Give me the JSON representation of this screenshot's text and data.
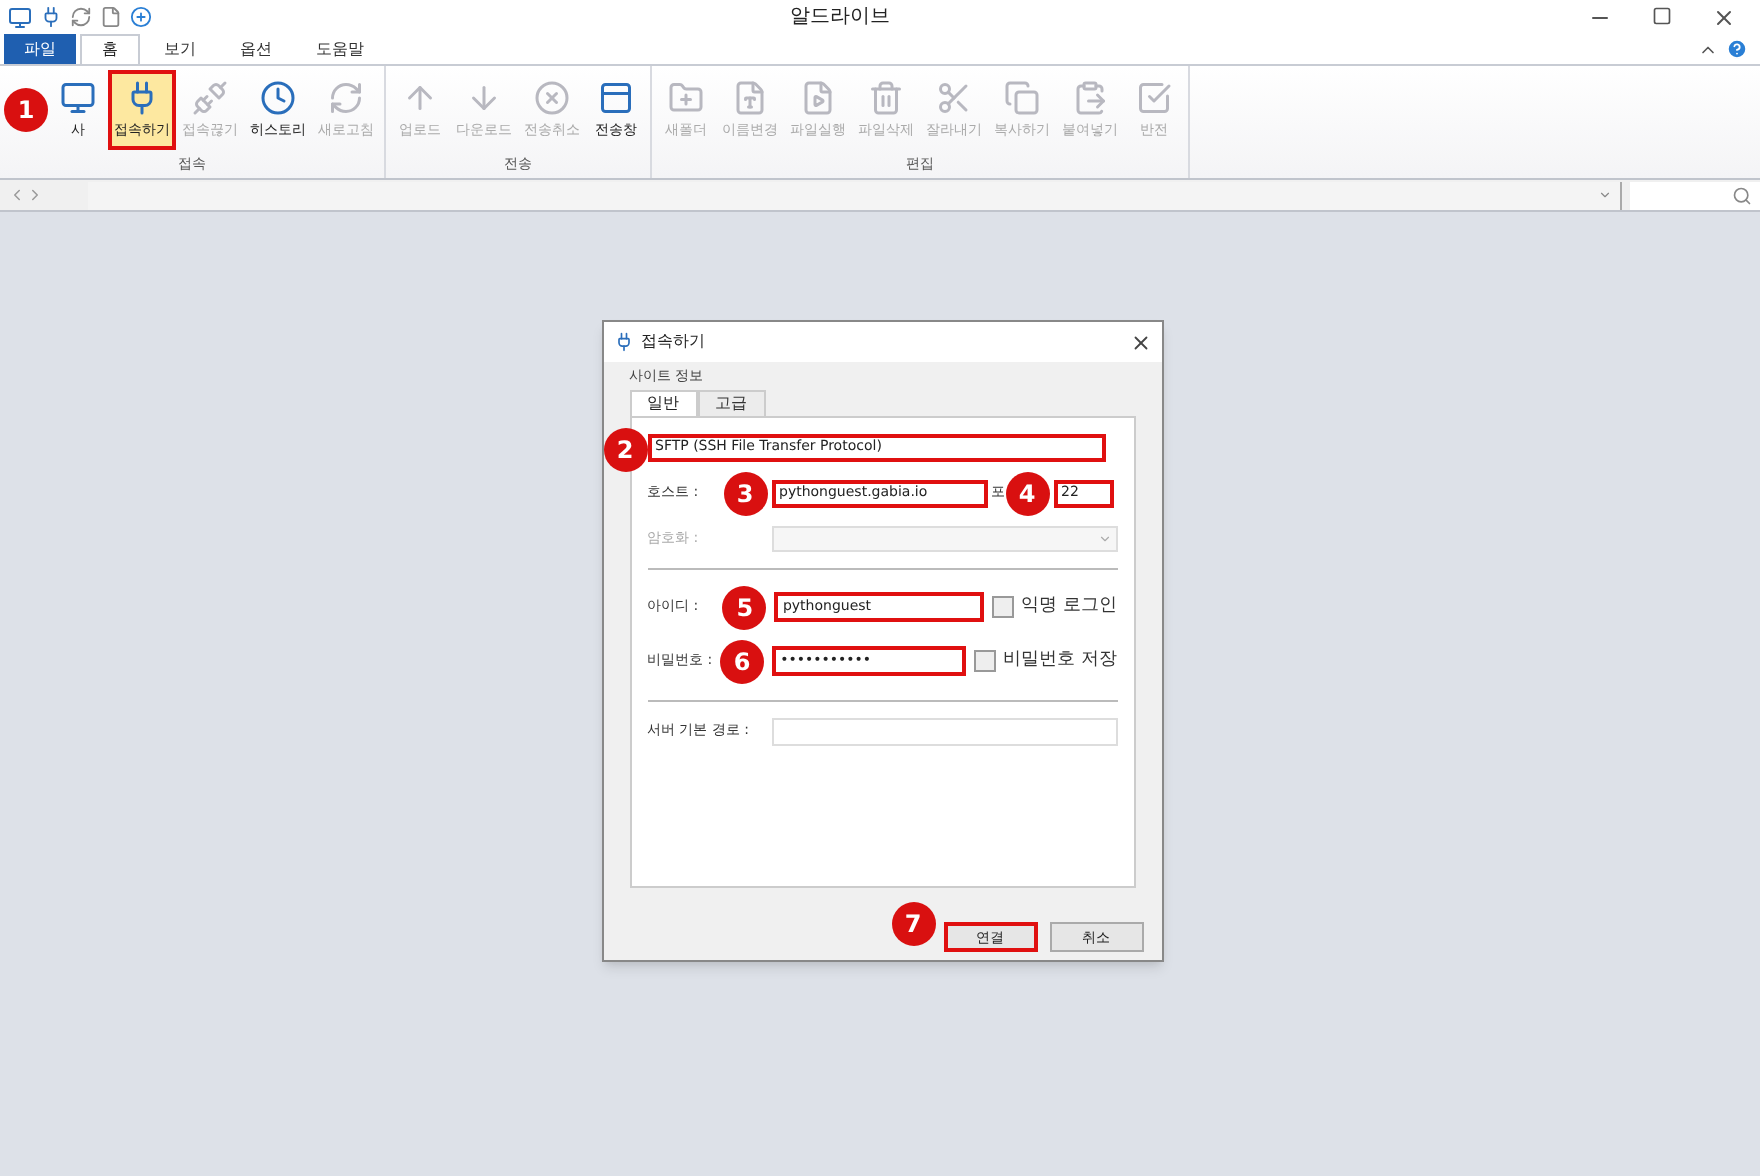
{
  "window": {
    "title": "알드라이브"
  },
  "menu_tabs": [
    {
      "label": "파일",
      "kind": "file",
      "selected": false
    },
    {
      "label": "홈",
      "kind": "tab",
      "selected": true
    },
    {
      "label": "보기",
      "kind": "tab",
      "selected": false
    },
    {
      "label": "옵션",
      "kind": "tab",
      "selected": false
    },
    {
      "label": "도움말",
      "kind": "tab",
      "selected": false
    }
  ],
  "ribbon_groups": [
    {
      "label": "접속",
      "buttons": [
        {
          "label": "사",
          "disabled": false,
          "highlighted": false,
          "badge": "1"
        },
        {
          "label": "접속하기",
          "disabled": false,
          "highlighted": true
        },
        {
          "label": "접속끊기",
          "disabled": true,
          "highlighted": false
        },
        {
          "label": "히스토리",
          "disabled": false,
          "highlighted": false
        },
        {
          "label": "새로고침",
          "disabled": true,
          "highlighted": false
        }
      ]
    },
    {
      "label": "전송",
      "buttons": [
        {
          "label": "업로드",
          "disabled": true,
          "highlighted": false
        },
        {
          "label": "다운로드",
          "disabled": true,
          "highlighted": false
        },
        {
          "label": "전송취소",
          "disabled": true,
          "highlighted": false
        },
        {
          "label": "전송창",
          "disabled": false,
          "highlighted": false
        }
      ]
    },
    {
      "label": "편집",
      "buttons": [
        {
          "label": "새폴더",
          "disabled": true,
          "highlighted": false
        },
        {
          "label": "이름변경",
          "disabled": true,
          "highlighted": false
        },
        {
          "label": "파일실행",
          "disabled": true,
          "highlighted": false
        },
        {
          "label": "파일삭제",
          "disabled": true,
          "highlighted": false
        },
        {
          "label": "잘라내기",
          "disabled": true,
          "highlighted": false
        },
        {
          "label": "복사하기",
          "disabled": true,
          "highlighted": false
        },
        {
          "label": "붙여넣기",
          "disabled": true,
          "highlighted": false
        },
        {
          "label": "반전",
          "disabled": true,
          "highlighted": false
        }
      ]
    }
  ],
  "dialog": {
    "title": "접속하기",
    "group_label": "사이트 정보",
    "tabs": [
      {
        "label": "일반",
        "selected": true
      },
      {
        "label": "고급",
        "selected": false
      }
    ],
    "protocol": {
      "value": "SFTP (SSH File Transfer Protocol)",
      "badge": "2"
    },
    "host": {
      "label": "호스트 :",
      "value": "pythonguest.gabia.io",
      "badge": "3"
    },
    "port": {
      "label": "포",
      "value": "22",
      "badge": "4"
    },
    "encryption": {
      "label": "암호화 :",
      "disabled": true
    },
    "user_id": {
      "label": "아이디 :",
      "value": "pythonguest",
      "badge": "5"
    },
    "anonymous": {
      "label": "익명 로그인",
      "checked": false
    },
    "password": {
      "label": "비밀번호 :",
      "value": "•••••••••••",
      "badge": "6"
    },
    "save_password": {
      "label": "비밀번호 저장",
      "checked": false
    },
    "base_path": {
      "label": "서버 기본 경로 :"
    },
    "buttons": [
      {
        "label": "연결",
        "highlighted": true,
        "badge": "7"
      },
      {
        "label": "취소",
        "highlighted": false
      }
    ]
  }
}
